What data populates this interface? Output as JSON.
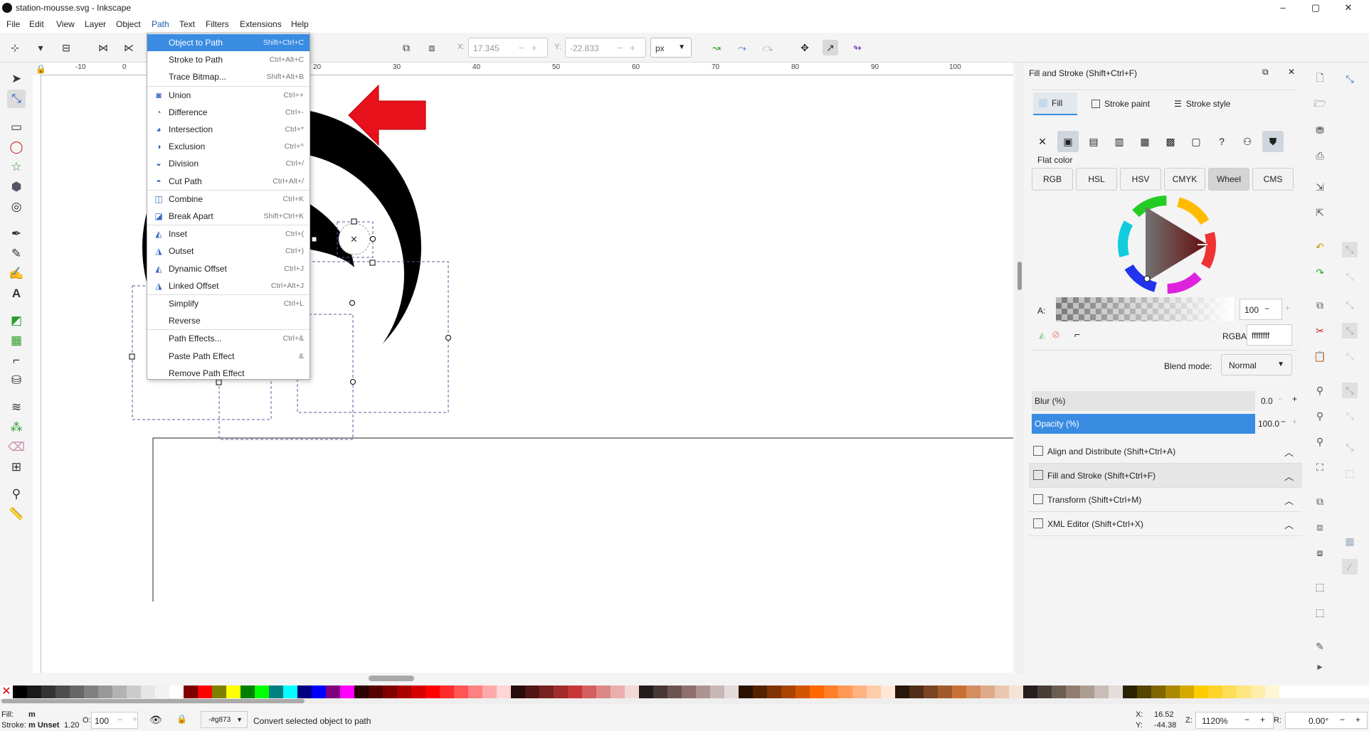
{
  "window": {
    "title": "station-mousse.svg - Inkscape",
    "minimize": "–",
    "maximize": "▢",
    "close": "✕"
  },
  "menubar": [
    "File",
    "Edit",
    "View",
    "Layer",
    "Object",
    "Path",
    "Text",
    "Filters",
    "Extensions",
    "Help"
  ],
  "toolbar": {
    "x_label": "X:",
    "x_value": "17.345",
    "y_label": "Y:",
    "y_value": "-22.833",
    "unit": "px"
  },
  "ruler": {
    "h": [
      "-10",
      "0",
      "10",
      "20",
      "30",
      "40",
      "50",
      "60",
      "70",
      "80",
      "90",
      "100"
    ]
  },
  "path_menu": [
    {
      "label": "Object to Path",
      "shortcut": "Shift+Ctrl+C",
      "icon": "",
      "highlighted": true
    },
    {
      "label": "Stroke to Path",
      "shortcut": "Ctrl+Alt+C",
      "icon": ""
    },
    {
      "label": "Trace Bitmap...",
      "shortcut": "Shift+Alt+B",
      "icon": ""
    },
    {
      "sep": true
    },
    {
      "label": "Union",
      "shortcut": "Ctrl++",
      "icon": "union-icon"
    },
    {
      "label": "Difference",
      "shortcut": "Ctrl+-",
      "icon": "difference-icon"
    },
    {
      "label": "Intersection",
      "shortcut": "Ctrl+*",
      "icon": "intersection-icon"
    },
    {
      "label": "Exclusion",
      "shortcut": "Ctrl+^",
      "icon": "exclusion-icon"
    },
    {
      "label": "Division",
      "shortcut": "Ctrl+/",
      "icon": "division-icon"
    },
    {
      "label": "Cut Path",
      "shortcut": "Ctrl+Alt+/",
      "icon": "cut-path-icon"
    },
    {
      "sep": true
    },
    {
      "label": "Combine",
      "shortcut": "Ctrl+K",
      "icon": "combine-icon"
    },
    {
      "label": "Break Apart",
      "shortcut": "Shift+Ctrl+K",
      "icon": "break-apart-icon"
    },
    {
      "sep": true
    },
    {
      "label": "Inset",
      "shortcut": "Ctrl+(",
      "icon": "inset-icon"
    },
    {
      "label": "Outset",
      "shortcut": "Ctrl+)",
      "icon": "outset-icon"
    },
    {
      "label": "Dynamic Offset",
      "shortcut": "Ctrl+J",
      "icon": "dynamic-offset-icon"
    },
    {
      "label": "Linked Offset",
      "shortcut": "Ctrl+Alt+J",
      "icon": "linked-offset-icon"
    },
    {
      "sep": true
    },
    {
      "label": "Simplify",
      "shortcut": "Ctrl+L",
      "icon": ""
    },
    {
      "label": "Reverse",
      "shortcut": "",
      "icon": ""
    },
    {
      "sep": true
    },
    {
      "label": "Path Effects...",
      "shortcut": "Ctrl+&",
      "icon": ""
    },
    {
      "label": "Paste Path Effect",
      "shortcut": "&",
      "icon": ""
    },
    {
      "label": "Remove Path Effect",
      "shortcut": "",
      "icon": ""
    }
  ],
  "fill_stroke": {
    "title": "Fill and Stroke (Shift+Ctrl+F)",
    "tabs": [
      "Fill",
      "Stroke paint",
      "Stroke style"
    ],
    "paint_icons": [
      "no-paint-icon",
      "flat-color-icon",
      "linear-gradient-icon",
      "radial-gradient-icon",
      "mesh-gradient-icon",
      "pattern-icon",
      "swatch-icon",
      "unset-icon",
      "fill-rule-evenodd-icon",
      "fill-rule-nonzero-icon"
    ],
    "paint_glyphs": [
      "✕",
      "",
      "",
      "",
      "",
      "",
      "",
      "?",
      "",
      ""
    ],
    "flat_color": "Flat color",
    "color_modes": [
      "RGB",
      "HSL",
      "HSV",
      "CMYK",
      "Wheel",
      "CMS"
    ],
    "active_mode": "Wheel",
    "alpha_label": "A:",
    "alpha_value": "100",
    "rgba_label": "RGBA:",
    "rgba_value": "ffffffff",
    "blend_label": "Blend mode:",
    "blend_value": "Normal",
    "blur_label": "Blur (%)",
    "blur_value": "0.0",
    "opacity_label": "Opacity (%)",
    "opacity_value": "100.0",
    "opacity_level": 1.0,
    "accent": "#3a8be2"
  },
  "dock_sections": [
    {
      "title": "Align and Distribute (Shift+Ctrl+A)",
      "icon": "align-icon"
    },
    {
      "title": "Fill and Stroke (Shift+Ctrl+F)",
      "icon": "fill-stroke-icon"
    },
    {
      "title": "Transform (Shift+Ctrl+M)",
      "icon": "transform-icon"
    },
    {
      "title": "XML Editor (Shift+Ctrl+X)",
      "icon": "xml-editor-icon"
    }
  ],
  "status": {
    "fill_label": "Fill:",
    "fill_value": "m",
    "stroke_label": "Stroke:",
    "stroke_value": "m Unset",
    "stroke_width": "1.20",
    "opacity_label": "O:",
    "opacity_value": "100",
    "layer": "-#g873",
    "message": "Convert selected object to path",
    "x_label": "X:",
    "x_value": "16.52",
    "y_label": "Y:",
    "y_value": "-44.38",
    "zoom_label": "Z:",
    "zoom_value": "1120%",
    "rot_label": "R:",
    "rot_value": "0.00°"
  },
  "palette_colors": [
    "#000000",
    "#1a1a1a",
    "#333333",
    "#4d4d4d",
    "#666666",
    "#808080",
    "#999999",
    "#b3b3b3",
    "#cccccc",
    "#e6e6e6",
    "#f2f2f2",
    "#ffffff",
    "#800000",
    "#ff0000",
    "#808000",
    "#ffff00",
    "#008000",
    "#00ff00",
    "#008080",
    "#00ffff",
    "#000080",
    "#0000ff",
    "#800080",
    "#ff00ff",
    "#2b0000",
    "#550000",
    "#800000",
    "#aa0000",
    "#d40000",
    "#ff0000",
    "#ff2a2a",
    "#ff5555",
    "#ff8080",
    "#ffaaaa",
    "#ffd5d5",
    "#280b0b",
    "#501616",
    "#782121",
    "#a02c2c",
    "#c83737",
    "#d35f5f",
    "#de8787",
    "#e9afaf",
    "#f4d7d7",
    "#241c1c",
    "#483737",
    "#6c5353",
    "#916f6f",
    "#ac9393",
    "#c8b7b7",
    "#e3dbdb",
    "#2b1100",
    "#552200",
    "#803300",
    "#aa4400",
    "#d45500",
    "#ff6600",
    "#ff7f2a",
    "#ff9955",
    "#ffb380",
    "#ffccaa",
    "#ffe6d5",
    "#28170b",
    "#502d16",
    "#784421",
    "#a05a2c",
    "#c87137",
    "#d38d5f",
    "#deaa87",
    "#e9c6af",
    "#f4e3d7",
    "#241f1c",
    "#483e37",
    "#6c5d53",
    "#917c6f",
    "#ac9d93",
    "#c8beb7",
    "#e3dedb",
    "#2b2200",
    "#554400",
    "#806600",
    "#aa8800",
    "#d4aa00",
    "#ffcc00",
    "#ffd42a",
    "#ffdd55",
    "#ffe680",
    "#ffeeaa",
    "#fff6d5"
  ]
}
